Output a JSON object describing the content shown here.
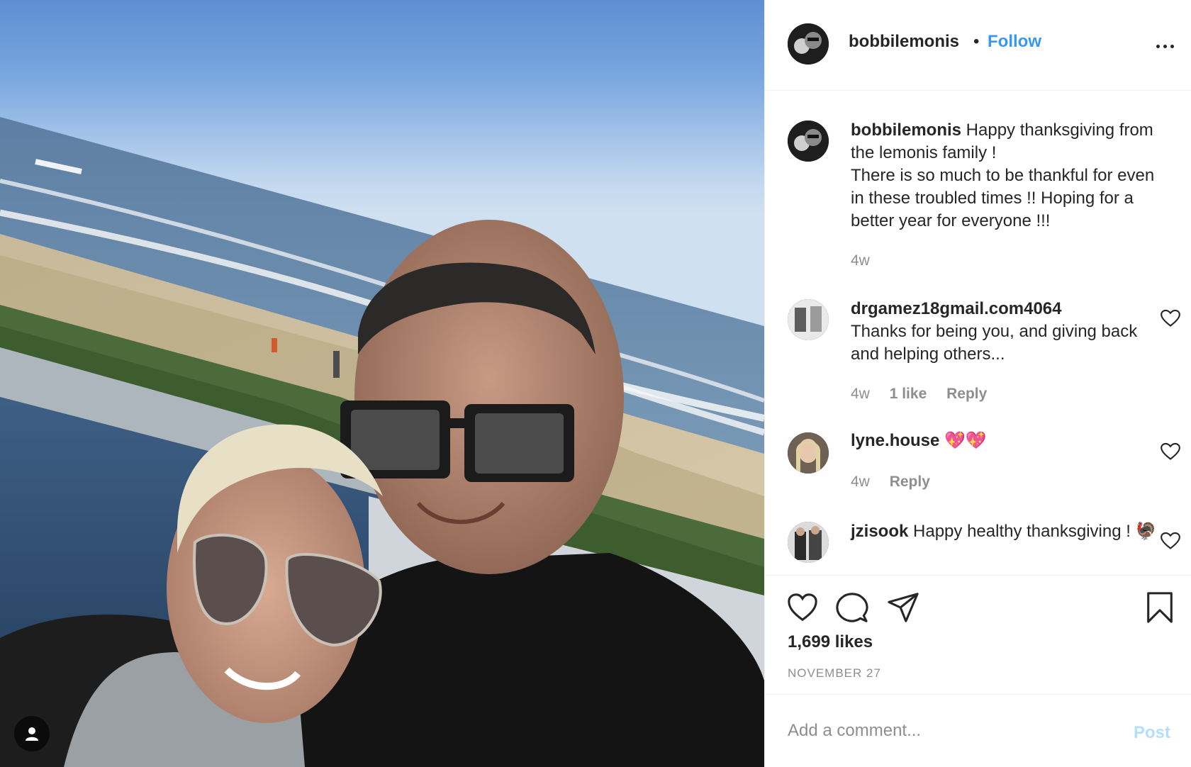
{
  "post": {
    "image_alt": "",
    "tag_icon": "person-tag-icon"
  },
  "header": {
    "username": "bobbilemonis",
    "separator": "•",
    "follow_label": "Follow",
    "more_icon": "more-options-icon"
  },
  "caption": {
    "username": "bobbilemonis",
    "text": "Happy thanksgiving from the lemonis family !",
    "line2": "There is so much to be thankful for even in these troubled times !! Hoping for a better year for everyone !!!",
    "time": "4w"
  },
  "comments": [
    {
      "username": "drgamez18gmail.com4064",
      "text": "Thanks for being you, and giving back and helping others...",
      "time": "4w",
      "likes": "1 like",
      "reply": "Reply"
    },
    {
      "username": "lyne.house",
      "text": "💖💖",
      "time": "4w",
      "reply": "Reply"
    },
    {
      "username": "jzisook",
      "text": "Happy healthy thanksgiving ! 🦃"
    }
  ],
  "actions": {
    "like_icon": "heart-icon",
    "comment_icon": "comment-icon",
    "share_icon": "paper-plane-icon",
    "save_icon": "bookmark-icon",
    "likes": "1,699 likes",
    "date": "NOVEMBER 27"
  },
  "add_comment": {
    "placeholder": "Add a comment...",
    "post_label": "Post"
  },
  "colors": {
    "link": "#3897f0",
    "muted": "#8e8e8e",
    "post_disabled": "#b2dffc"
  }
}
